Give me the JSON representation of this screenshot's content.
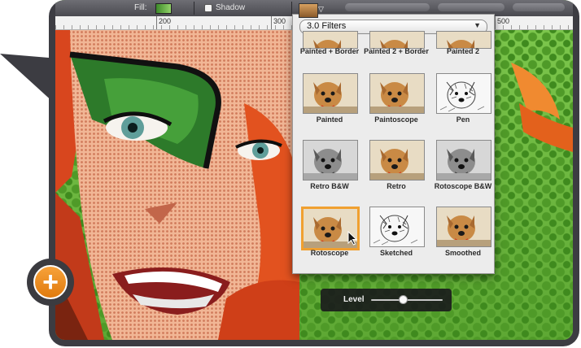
{
  "toolbar": {
    "fill_label": "Fill:",
    "shadow_label": "Shadow"
  },
  "ruler": {
    "numbers": [
      "200",
      "300",
      "500"
    ]
  },
  "filter_panel": {
    "preset_selected": "3.0 Filters",
    "filters": [
      {
        "label": "Painted + Border",
        "style": "color"
      },
      {
        "label": "Painted 2 + Border",
        "style": "color"
      },
      {
        "label": "Painted 2",
        "style": "color"
      },
      {
        "label": "Painted",
        "style": "color"
      },
      {
        "label": "Paintoscope",
        "style": "color"
      },
      {
        "label": "Pen",
        "style": "sketch"
      },
      {
        "label": "Retro B&W",
        "style": "bw"
      },
      {
        "label": "Retro",
        "style": "color"
      },
      {
        "label": "Rotoscope B&W",
        "style": "bw"
      },
      {
        "label": "Rotoscope",
        "style": "color"
      },
      {
        "label": "Sketched",
        "style": "sketch"
      },
      {
        "label": "Smoothed",
        "style": "color"
      }
    ],
    "selected_filter": "Rotoscope"
  },
  "level_control": {
    "label": "Level",
    "value": 0.45
  },
  "colors": {
    "accent": "#f0a030",
    "canvas_green": "#6fb543",
    "frame": "#3c3c42"
  },
  "icons": {
    "add": "plus-icon",
    "dropdown": "chevron-down-icon",
    "cursor": "arrow-cursor-icon"
  }
}
